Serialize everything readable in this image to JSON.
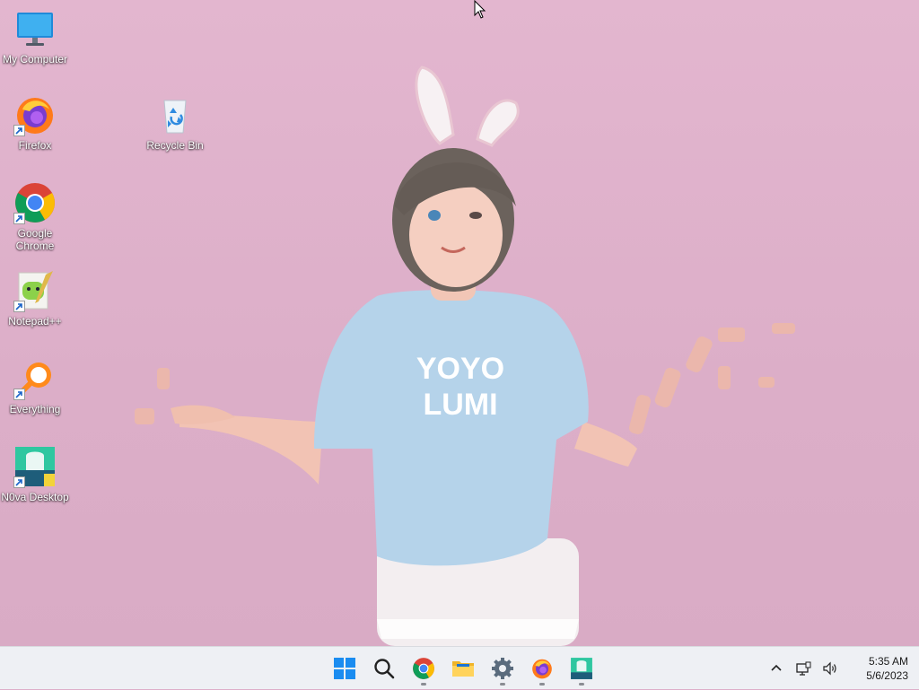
{
  "desktop": {
    "icons": [
      {
        "label": "My Computer",
        "icon": "monitor-icon"
      },
      {
        "label": "Firefox",
        "icon": "firefox-icon"
      },
      {
        "label": "Recycle Bin",
        "icon": "recycle-bin-icon"
      },
      {
        "label": "Google Chrome",
        "icon": "chrome-icon"
      },
      {
        "label": "Notepad++",
        "icon": "notepadpp-icon"
      },
      {
        "label": "Everything",
        "icon": "everything-search-icon"
      },
      {
        "label": "N0va Desktop",
        "icon": "n0va-desktop-icon"
      }
    ],
    "wallpaper": {
      "shirt_text_line1": "YOYO",
      "shirt_text_line2": "LUMI",
      "background_color": "#ddaec9"
    }
  },
  "taskbar": {
    "pinned": [
      {
        "name": "start",
        "icon": "windows-start-icon"
      },
      {
        "name": "search",
        "icon": "search-icon"
      },
      {
        "name": "chrome",
        "icon": "chrome-icon"
      },
      {
        "name": "file-explorer",
        "icon": "folder-icon"
      },
      {
        "name": "settings",
        "icon": "gear-icon"
      },
      {
        "name": "firefox",
        "icon": "firefox-icon"
      },
      {
        "name": "n0va-desktop",
        "icon": "n0va-desktop-icon"
      }
    ],
    "tray": {
      "overflow_icon": "chevron-up-icon",
      "network_icon": "network-icon",
      "volume_icon": "speaker-icon",
      "time": "5:35 AM",
      "date": "5/6/2023"
    }
  }
}
